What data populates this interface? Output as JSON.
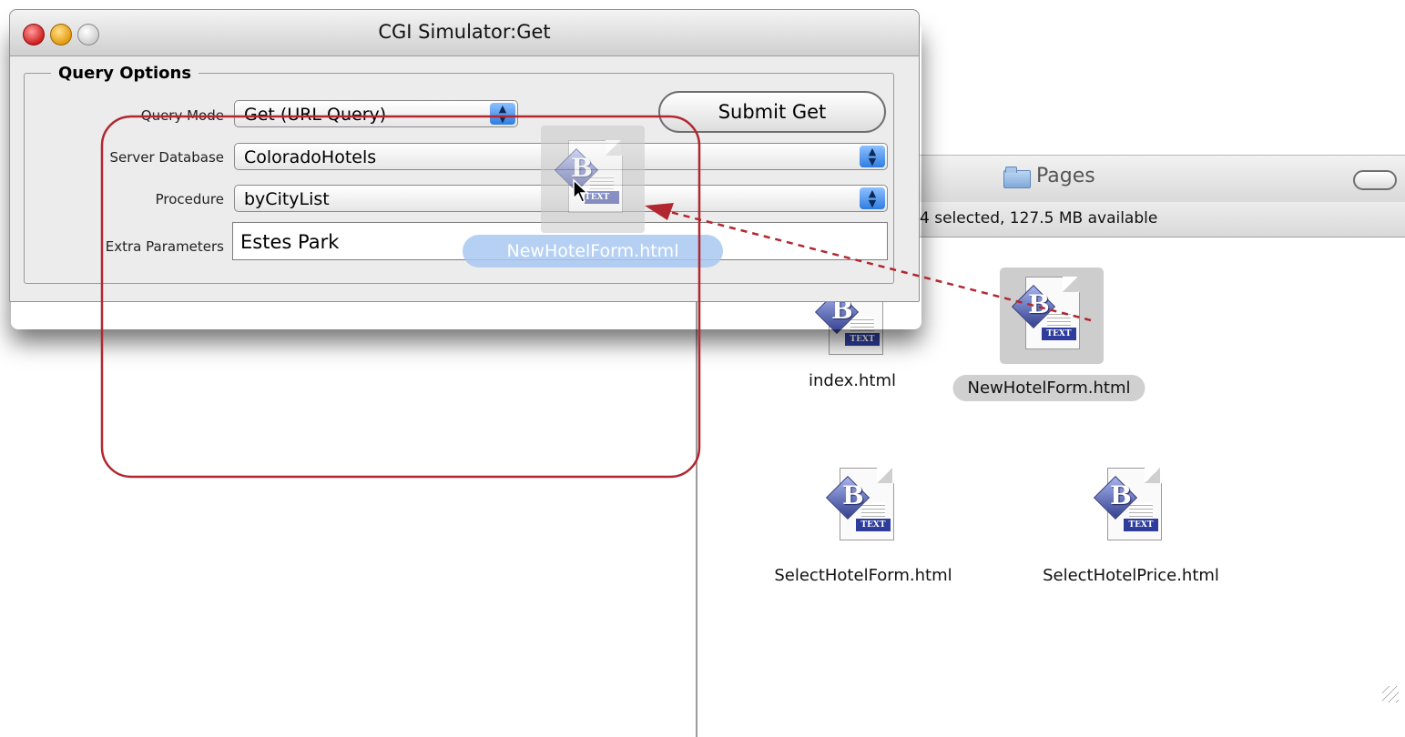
{
  "cgi_window": {
    "title": "CGI Simulator:Get",
    "group_title": "Query Options",
    "query_mode_label": "Query Mode",
    "query_mode_value": "Get (URL Query)",
    "server_database_label": "Server Database",
    "server_database_value": "ColoradoHotels",
    "procedure_label": "Procedure",
    "procedure_value": "byCityList",
    "extra_parameters_label": "Extra Parameters",
    "extra_parameters_value": "Estes Park",
    "submit_label": "Submit Get"
  },
  "drag": {
    "ghost_label": "NewHotelForm.html"
  },
  "finder": {
    "title": "Pages",
    "status": "4 selected, 127.5 MB available",
    "files": [
      {
        "name": "index.html",
        "selected": false
      },
      {
        "name": "NewHotelForm.html",
        "selected": true
      },
      {
        "name": "SelectHotelForm.html",
        "selected": false
      },
      {
        "name": "SelectHotelPrice.html",
        "selected": false
      }
    ]
  },
  "icons": {
    "file_icon": "bbedit-text-document-icon",
    "folder_icon": "folder-icon",
    "cursor": "arrow-cursor-icon"
  },
  "colors": {
    "annotation": "#b2272f",
    "popup_arrows": "#2f7de0",
    "selection": "#cdcdcd",
    "drag_label": "#a9c8f2"
  }
}
